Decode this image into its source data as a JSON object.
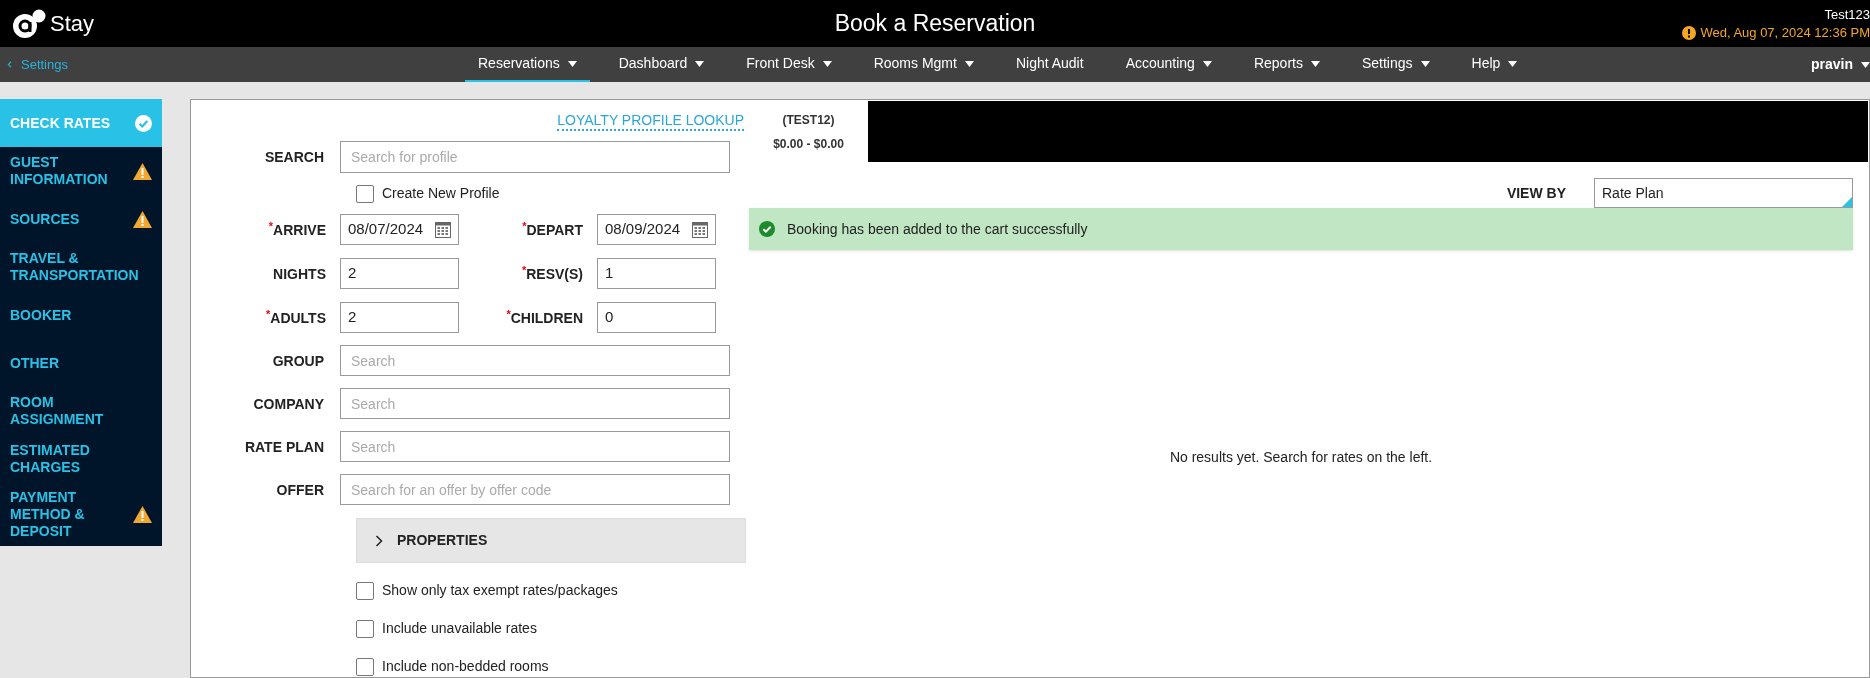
{
  "header": {
    "logo_text": "Stay",
    "title": "Book a Reservation",
    "user_code": "Test123",
    "datetime": "Wed, Aug 07, 2024 12:36 PM"
  },
  "nav": {
    "back": "Settings",
    "user": "pravin",
    "items": [
      {
        "label": "Reservations",
        "dropdown": true,
        "selected": true
      },
      {
        "label": "Dashboard",
        "dropdown": true,
        "selected": false
      },
      {
        "label": "Front Desk",
        "dropdown": true,
        "selected": false
      },
      {
        "label": "Rooms Mgmt",
        "dropdown": true,
        "selected": false
      },
      {
        "label": "Night Audit",
        "dropdown": false,
        "selected": false
      },
      {
        "label": "Accounting",
        "dropdown": true,
        "selected": false
      },
      {
        "label": "Reports",
        "dropdown": true,
        "selected": false
      },
      {
        "label": "Settings",
        "dropdown": true,
        "selected": false
      },
      {
        "label": "Help",
        "dropdown": true,
        "selected": false
      }
    ]
  },
  "sidebar": {
    "items": [
      {
        "label": "CHECK RATES",
        "selected": true,
        "complete": true,
        "warning": false
      },
      {
        "label": "GUEST INFORMATION",
        "selected": false,
        "complete": false,
        "warning": true
      },
      {
        "label": "SOURCES",
        "selected": false,
        "complete": false,
        "warning": true
      },
      {
        "label": "TRAVEL & TRANSPORTATION",
        "selected": false,
        "complete": false,
        "warning": false
      },
      {
        "label": "BOOKER",
        "selected": false,
        "complete": false,
        "warning": false
      },
      {
        "label": "OTHER",
        "selected": false,
        "complete": false,
        "warning": false
      },
      {
        "label": "ROOM ASSIGNMENT",
        "selected": false,
        "complete": false,
        "warning": false
      },
      {
        "label": "ESTIMATED CHARGES",
        "selected": false,
        "complete": false,
        "warning": false
      },
      {
        "label": "PAYMENT METHOD & DEPOSIT",
        "selected": false,
        "complete": false,
        "warning": true
      }
    ]
  },
  "form": {
    "loyalty_link": "LOYALTY PROFILE LOOKUP",
    "required_mark": "*",
    "search": {
      "label": "SEARCH",
      "placeholder": "Search for profile"
    },
    "create_profile": {
      "label": "Create New Profile",
      "checked": false
    },
    "pairs": [
      [
        {
          "label": "ARRIVE",
          "required": true,
          "value": "08/07/2024",
          "kind": "date"
        },
        {
          "label": "DEPART",
          "required": true,
          "value": "08/09/2024",
          "kind": "date"
        }
      ],
      [
        {
          "label": "NIGHTS",
          "required": false,
          "value": "2",
          "kind": "text"
        },
        {
          "label": "RESV(S)",
          "required": true,
          "value": "1",
          "kind": "text"
        }
      ],
      [
        {
          "label": "ADULTS",
          "required": true,
          "value": "2",
          "kind": "text"
        },
        {
          "label": "CHILDREN",
          "required": true,
          "value": "0",
          "kind": "text"
        }
      ]
    ],
    "fields": [
      {
        "label": "GROUP",
        "placeholder": "Search"
      },
      {
        "label": "COMPANY",
        "placeholder": "Search"
      },
      {
        "label": "RATE PLAN",
        "placeholder": "Search"
      },
      {
        "label": "OFFER",
        "placeholder": "Search for an offer by offer code"
      }
    ],
    "properties": {
      "label": "PROPERTIES",
      "expanded": false
    },
    "options": [
      {
        "label": "Show only tax exempt rates/packages",
        "checked": false
      },
      {
        "label": "Include unavailable rates",
        "checked": false
      },
      {
        "label": "Include non-bedded rooms",
        "checked": false
      }
    ]
  },
  "results": {
    "tab": {
      "code": "(TEST12)",
      "range": "$0.00 - $0.00",
      "selected": true
    },
    "view_by": {
      "label": "VIEW BY",
      "value": "Rate Plan"
    },
    "alert": "Booking has been added to the cart successfully",
    "empty": "No results yet. Search for rates on the left."
  }
}
